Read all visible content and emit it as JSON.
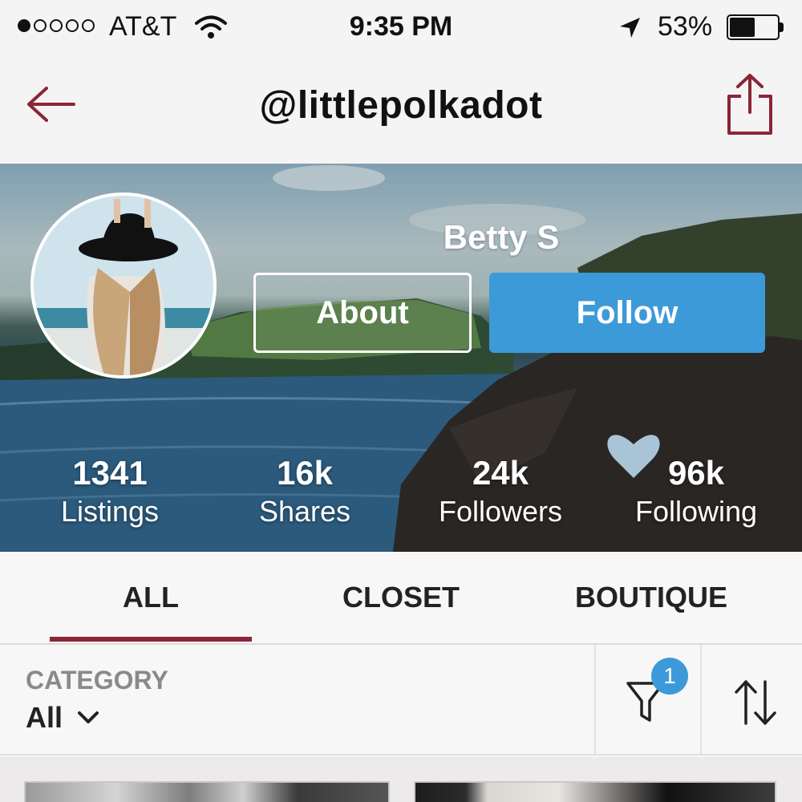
{
  "status_bar": {
    "carrier": "AT&T",
    "time": "9:35 PM",
    "battery_percent": "53%",
    "battery_level": 0.53,
    "signal_bars": 1,
    "signal_total": 5
  },
  "nav": {
    "title": "@littlepolkadot",
    "back_icon": "arrow-left-icon",
    "share_icon": "share-icon",
    "accent_color": "#8a2637"
  },
  "profile": {
    "name": "Betty S",
    "about_label": "About",
    "follow_label": "Follow",
    "follow_color": "#3d9ad8",
    "stats": [
      {
        "value": "1341",
        "label": "Listings"
      },
      {
        "value": "16k",
        "label": "Shares"
      },
      {
        "value": "24k",
        "label": "Followers"
      },
      {
        "value": "96k",
        "label": "Following"
      }
    ]
  },
  "tabs": [
    {
      "label": "ALL",
      "active": true
    },
    {
      "label": "CLOSET",
      "active": false
    },
    {
      "label": "BOUTIQUE",
      "active": false
    }
  ],
  "filters": {
    "category_label": "CATEGORY",
    "category_value": "All",
    "filter_badge": "1",
    "filter_icon": "funnel-icon",
    "sort_icon": "sort-arrows-icon"
  }
}
